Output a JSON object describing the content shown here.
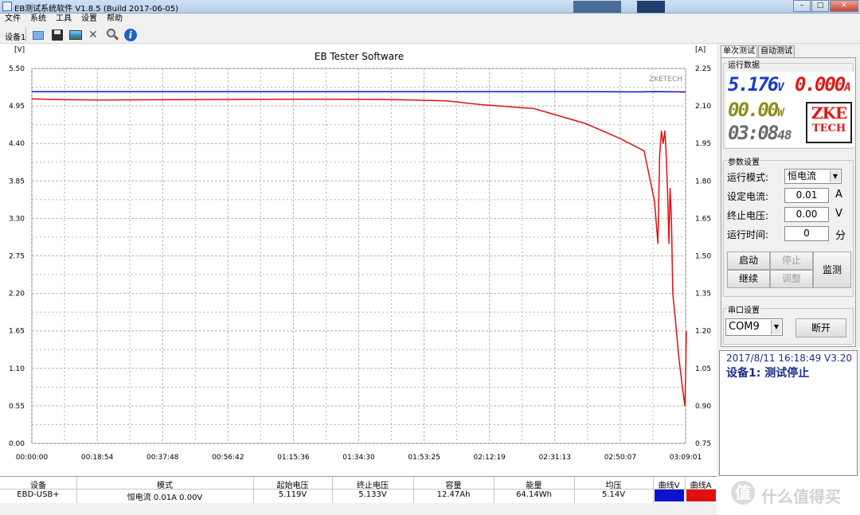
{
  "window": {
    "title": "EB测试系统软件 V1.8.5 (Build 2017-06-05)",
    "controls": {
      "minimize": "–",
      "maximize": "□",
      "close": "✕"
    }
  },
  "menu": [
    "文件",
    "系统",
    "工具",
    "设置",
    "帮助"
  ],
  "toolbar": {
    "device_label": "设备1",
    "icons": [
      "folder-open-icon",
      "save-icon",
      "image-icon",
      "tools-icon",
      "search-icon",
      "info-icon"
    ]
  },
  "tabs": [
    "单次测试",
    "自动测试"
  ],
  "running_data": {
    "group_title": "运行数据",
    "voltage": "5.176",
    "voltage_unit": "V",
    "current": "0.000",
    "current_unit": "A",
    "power": "00.00",
    "power_unit": "W",
    "time_main": "03:08",
    "time_sec": "48",
    "logo_line1": "ZKE",
    "logo_line2": "TECH"
  },
  "params": {
    "group_title": "参数设置",
    "mode_label": "运行模式:",
    "mode_value": "恒电流",
    "current_label": "设定电流:",
    "current_value": "0.01",
    "current_unit": "A",
    "cutoff_label": "终止电压:",
    "cutoff_value": "0.00",
    "cutoff_unit": "V",
    "time_label": "运行时间:",
    "time_value": "0",
    "time_unit": "分",
    "btn_start": "启动",
    "btn_stop": "停止",
    "btn_continue": "继续",
    "btn_adjust": "调整",
    "btn_monitor": "监测"
  },
  "serial": {
    "group_title": "串口设置",
    "port": "COM9",
    "btn_disconnect": "断开"
  },
  "status": {
    "line1": "2017/8/11  16:18:49   V3.20",
    "line2": "设备1: 测试停止"
  },
  "table": {
    "headers": [
      "设备",
      "模式",
      "起始电压",
      "终止电压",
      "容量",
      "能量",
      "均压",
      "曲线V",
      "曲线A"
    ],
    "row": [
      "EBD-USB+",
      "恒电流  0.01A  0.00V",
      "5.119V",
      "5.133V",
      "12.47Ah",
      "64.14Wh",
      "5.14V",
      "",
      ""
    ]
  },
  "watermark": {
    "icon": "值",
    "text": "什么值得买"
  },
  "colors": {
    "voltage": "#1010d0",
    "current": "#e01010",
    "grid": "#b4b4b4"
  },
  "chart_data": {
    "type": "line",
    "title": "EB Tester Software",
    "watermark": "ZKETECH",
    "ylabel_left": "[V]",
    "ylabel_right": "[A]",
    "y_left_ticks": [
      "5.50",
      "4.95",
      "4.40",
      "3.85",
      "3.30",
      "2.75",
      "2.20",
      "1.65",
      "1.10",
      "0.55",
      "0.00"
    ],
    "y_right_ticks": [
      "2.25",
      "2.10",
      "1.95",
      "1.80",
      "1.65",
      "1.50",
      "1.35",
      "1.20",
      "1.05",
      "0.90",
      "0.75"
    ],
    "x_ticks": [
      "00:00:00",
      "00:18:54",
      "00:37:48",
      "00:56:42",
      "01:15:36",
      "01:34:30",
      "01:53:25",
      "02:12:19",
      "02:31:13",
      "02:50:07",
      "03:09:01"
    ],
    "ylim_left": [
      0,
      5.5
    ],
    "ylim_right": [
      0.75,
      2.25
    ],
    "xlim_min": [
      0,
      189.0
    ],
    "grid": true,
    "series": [
      {
        "name": "曲线V",
        "axis": "left",
        "color": "#1010d0",
        "points": [
          [
            0,
            5.16
          ],
          [
            40,
            5.16
          ],
          [
            80,
            5.16
          ],
          [
            120,
            5.16
          ],
          [
            160,
            5.16
          ],
          [
            175,
            5.155
          ],
          [
            180,
            5.16
          ],
          [
            189,
            5.155
          ]
        ]
      },
      {
        "name": "曲线A",
        "axis": "right",
        "color": "#e01010",
        "points": [
          [
            0,
            2.128
          ],
          [
            10,
            2.125
          ],
          [
            20,
            2.124
          ],
          [
            40,
            2.125
          ],
          [
            60,
            2.126
          ],
          [
            80,
            2.127
          ],
          [
            100,
            2.126
          ],
          [
            110,
            2.124
          ],
          [
            120,
            2.12
          ],
          [
            130,
            2.105
          ],
          [
            140,
            2.095
          ],
          [
            145,
            2.09
          ],
          [
            150,
            2.07
          ],
          [
            160,
            2.03
          ],
          [
            170,
            1.97
          ],
          [
            177,
            1.92
          ],
          [
            180,
            1.72
          ],
          [
            181,
            1.55
          ],
          [
            181.5,
            1.9
          ],
          [
            182,
            2.0
          ],
          [
            182.5,
            1.95
          ],
          [
            183,
            2.0
          ],
          [
            183.4,
            1.9
          ],
          [
            183.8,
            1.75
          ],
          [
            184.2,
            1.55
          ],
          [
            184.5,
            1.77
          ],
          [
            184.9,
            1.65
          ],
          [
            185.3,
            1.35
          ],
          [
            186,
            1.25
          ],
          [
            187,
            1.1
          ],
          [
            188,
            0.98
          ],
          [
            188.8,
            0.9
          ],
          [
            189,
            1.02
          ],
          [
            189.2,
            1.2
          ]
        ]
      }
    ]
  }
}
